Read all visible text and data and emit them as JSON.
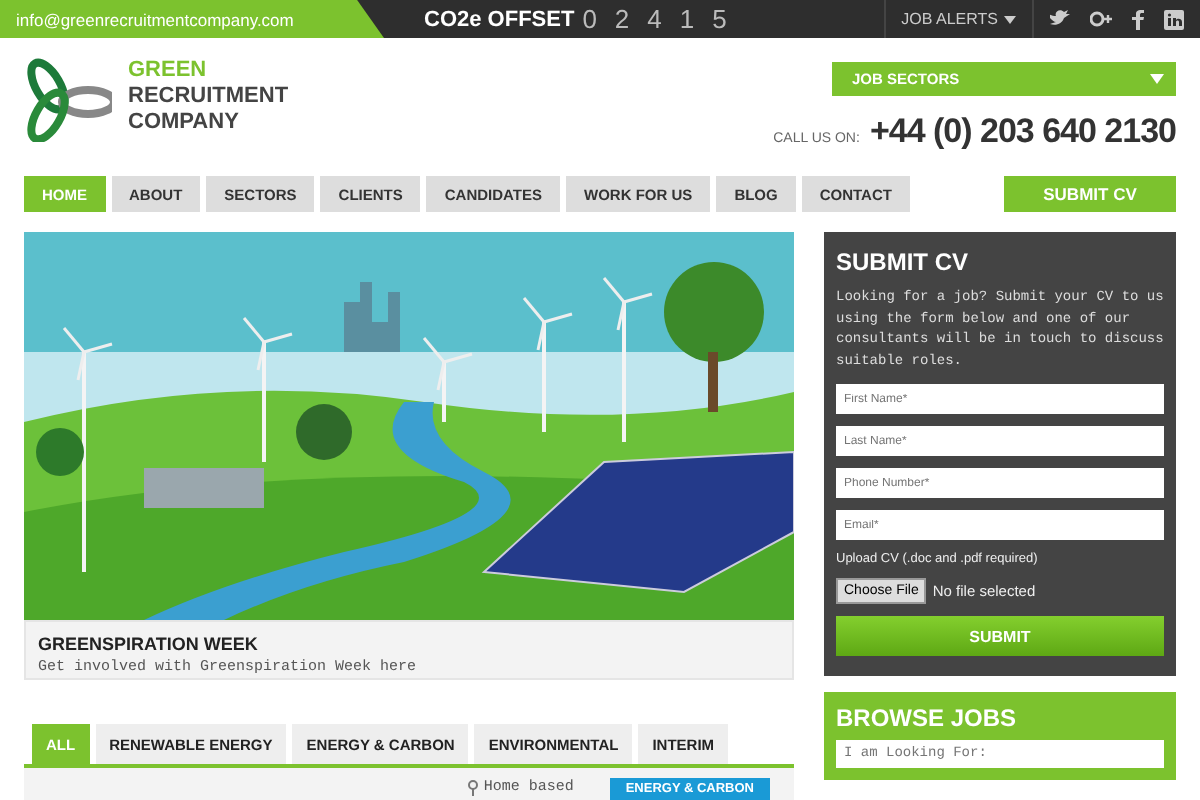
{
  "top_bar": {
    "email": "info@greenrecruitmentcompany.com",
    "offset_label": "CO2e OFFSET",
    "offset_digits": [
      "0",
      "2",
      "4",
      "1",
      "5"
    ],
    "job_alerts": "JOB ALERTS"
  },
  "logo": {
    "line1": "GREEN",
    "line2": "RECRUITMENT",
    "line3": "COMPANY"
  },
  "job_sectors": "JOB SECTORS",
  "call_label": "CALL US ON:",
  "phone": "+44 (0) 203 640 2130",
  "nav": [
    {
      "label": "HOME",
      "selected": true
    },
    {
      "label": "ABOUT",
      "selected": false
    },
    {
      "label": "SECTORS",
      "selected": false
    },
    {
      "label": "CLIENTS",
      "selected": false
    },
    {
      "label": "CANDIDATES",
      "selected": false
    },
    {
      "label": "WORK FOR US",
      "selected": false
    },
    {
      "label": "BLOG",
      "selected": false
    },
    {
      "label": "CONTACT",
      "selected": false
    }
  ],
  "submit_cv_button": "SUBMIT CV",
  "feature": {
    "title": "GREENSPIRATION WEEK",
    "text": "Get involved with Greenspiration Week here"
  },
  "job_tabs": [
    {
      "label": "ALL",
      "selected": true
    },
    {
      "label": "RENEWABLE ENERGY",
      "selected": false
    },
    {
      "label": "ENERGY & CARBON",
      "selected": false
    },
    {
      "label": "ENVIRONMENTAL",
      "selected": false
    },
    {
      "label": "INTERIM",
      "selected": false
    }
  ],
  "job_row": {
    "location": "Home based",
    "tag": "ENERGY & CARBON"
  },
  "cv_form": {
    "title": "SUBMIT CV",
    "intro": "Looking for a job? Submit your CV to us using the form below and one of our consultants will be in touch to discuss suitable roles.",
    "fields": [
      {
        "placeholder": "First Name*"
      },
      {
        "placeholder": "Last Name*"
      },
      {
        "placeholder": "Phone Number*"
      },
      {
        "placeholder": "Email*"
      }
    ],
    "upload_label": "Upload CV (.doc and .pdf required)",
    "choose_file": "Choose File",
    "no_file": "No file selected",
    "submit": "SUBMIT"
  },
  "browse": {
    "title": "BROWSE JOBS",
    "placeholder": "I am Looking For:"
  }
}
